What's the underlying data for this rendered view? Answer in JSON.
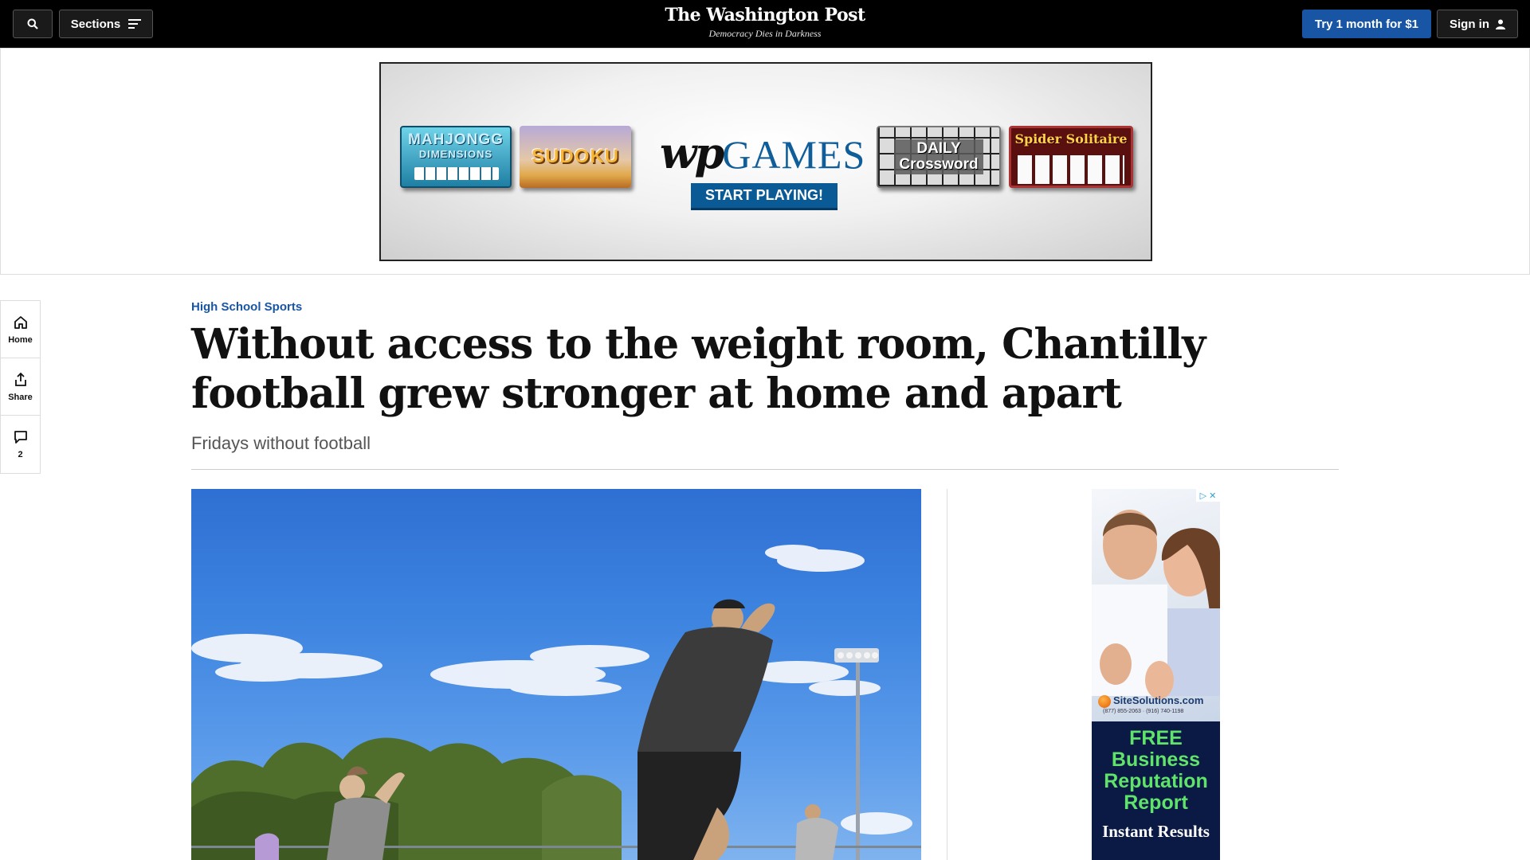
{
  "nav": {
    "sections_label": "Sections",
    "masthead_title": "The Washington Post",
    "masthead_tagline": "Democracy Dies in Darkness",
    "try_label": "Try 1 month for $1",
    "signin_label": "Sign in"
  },
  "banner_ad": {
    "tiles": {
      "mahjongg_line1": "MAHJONGG",
      "mahjongg_line2": "DIMENSIONS",
      "sudoku": "SUDOKU",
      "crossword_line1": "DAILY",
      "crossword_line2": "Crossword",
      "spider": "Spider Solitaire"
    },
    "brand_wp": "wp",
    "brand_games": "GAMES",
    "cta": "START PLAYING!"
  },
  "rail": {
    "home": "Home",
    "share": "Share",
    "comments_count": "2"
  },
  "article": {
    "kicker": "High School Sports",
    "headline": "Without access to the weight room, Chantilly football grew stronger at home and apart",
    "dek": "Fridays without football"
  },
  "side_ad": {
    "logo": "SiteSolutions.com",
    "phone": "(877) 855-2063 · (916) 740-1198",
    "free_line1": "FREE",
    "free_line2": "Business",
    "free_line3": "Reputation",
    "free_line4": "Report",
    "instant": "Instant Results"
  },
  "icons": [
    "search-icon",
    "menu-icon",
    "user-icon",
    "home-icon",
    "share-icon",
    "comment-icon",
    "adchoices-icon",
    "close-icon"
  ],
  "colors": {
    "accent": "#1955a5",
    "topbar": "#000000",
    "headline": "#111111",
    "dek": "#555555"
  }
}
